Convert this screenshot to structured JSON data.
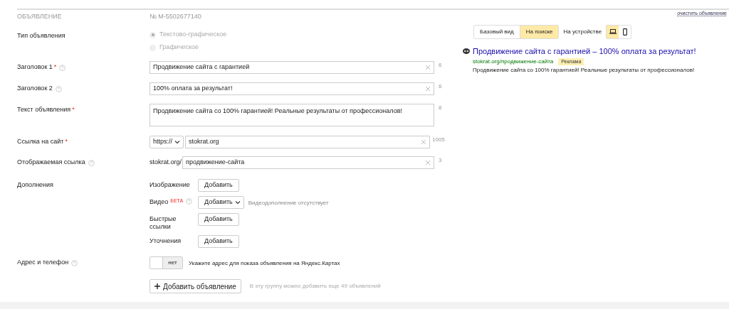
{
  "header": {
    "section_title": "ОБЪЯВЛЕНИЕ",
    "ad_number": "№ M-5502677140",
    "clear_link": "очистить объявление"
  },
  "fields": [
    {
      "kind": "radio",
      "label": "Тип объявления",
      "help": false,
      "options": [
        {
          "label": "Текстово-графическое",
          "selected": true,
          "disabled": true
        },
        {
          "label": "Графическое",
          "selected": false,
          "disabled": true
        }
      ]
    },
    {
      "kind": "text",
      "label": "Заголовок 1",
      "required_mark": "*",
      "help": true,
      "value": "Продвижение сайта с гарантией",
      "counter": "6"
    },
    {
      "kind": "text",
      "label": "Заголовок 2",
      "help": true,
      "value": "100% оплата за результат!",
      "counter": "6"
    },
    {
      "kind": "textarea",
      "label": "Текст объявления",
      "required_mark": "*",
      "help": false,
      "value": "Продвижение сайта со 100% гарантией! Реальные результаты от профессионалов!",
      "counter": "8"
    },
    {
      "kind": "url",
      "label": "Ссылка на сайт",
      "required_mark": "*",
      "help": false,
      "protocol": "https://",
      "value": "stokrat.org",
      "counter": "1005"
    },
    {
      "kind": "display_url",
      "label": "Отображаемая ссылка",
      "help": true,
      "prefix": "stokrat.org/",
      "value": "продвижение-сайта",
      "counter": "3"
    },
    {
      "kind": "extras",
      "label": "Дополнения",
      "help": false,
      "items": [
        {
          "label": "Изображение",
          "help": false,
          "button": "Добавить",
          "dropdown": false
        },
        {
          "label": "Видео",
          "badge": "БЕТА",
          "help": true,
          "button": "Добавить",
          "dropdown": true,
          "note": "Видеодополнение отсутствует"
        },
        {
          "label": "Быстрые ссылки",
          "help": false,
          "button": "Добавить",
          "dropdown": false
        },
        {
          "label": "Уточнения",
          "help": false,
          "button": "Добавить",
          "dropdown": false
        }
      ]
    },
    {
      "kind": "toggle",
      "label": "Адрес и телефон",
      "help": true,
      "on": false,
      "state_label": "нет",
      "note": "Укажите адрес для показа объявления на Яндекс.Картах"
    }
  ],
  "footer": {
    "add_button": "Добавить объявление",
    "note": "В эту группу можно добавить еще 49 объявлений"
  },
  "preview": {
    "tabs": [
      {
        "label": "Базовый вид",
        "selected": false
      },
      {
        "label": "На поиске",
        "selected": true
      }
    ],
    "device_label": "На устройстве",
    "devices": [
      {
        "kind": "desktop",
        "selected": true
      },
      {
        "kind": "mobile",
        "selected": false
      }
    ],
    "ad": {
      "title": "Продвижение сайта с гарантией – 100% оплата за результат!",
      "url": "stokrat.org/продвижение-сайта",
      "badge": "Реклама",
      "text": "Продвижение сайта со 100% гарантией! Реальные результаты от профессионалов!"
    }
  }
}
